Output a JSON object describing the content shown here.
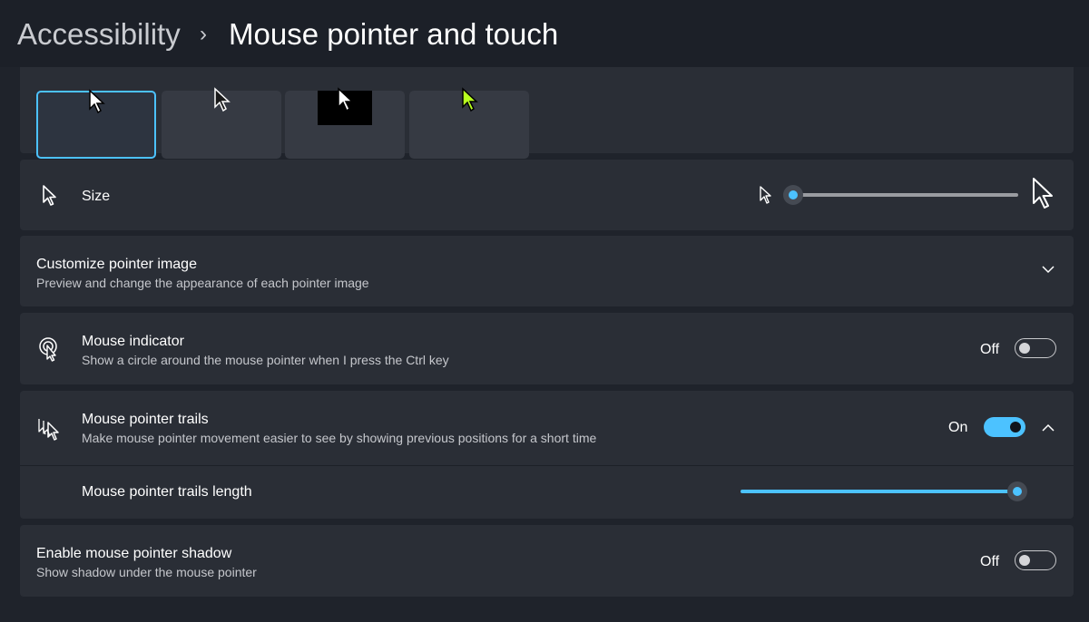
{
  "breadcrumb": {
    "parent": "Accessibility",
    "separator": "›",
    "current": "Mouse pointer and touch"
  },
  "pointer_style": {
    "options": [
      "white-pointer",
      "black-pointer",
      "inverted-pointer",
      "custom-color-pointer"
    ],
    "selected_index": 0
  },
  "size": {
    "label": "Size",
    "value_fraction": 0.0
  },
  "customize": {
    "title": "Customize pointer image",
    "subtitle": "Preview and change the appearance of each pointer image"
  },
  "indicator": {
    "title": "Mouse indicator",
    "subtitle": "Show a circle around the mouse pointer when I press the Ctrl key",
    "state": "Off"
  },
  "trails": {
    "title": "Mouse pointer trails",
    "subtitle": "Make mouse pointer movement easier to see by showing previous positions for a short time",
    "state": "On",
    "length_label": "Mouse pointer trails length",
    "length_fraction": 1.0
  },
  "shadow": {
    "title": "Enable mouse pointer shadow",
    "subtitle": "Show shadow under the mouse pointer",
    "state": "Off"
  },
  "colors": {
    "accent": "#4cc2ff",
    "card": "#2a2e36",
    "background": "#1f232b"
  }
}
